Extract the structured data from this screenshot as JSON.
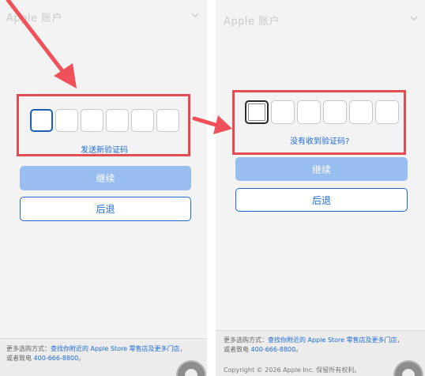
{
  "left": {
    "header_title": "Apple 账户",
    "link": "发送新验证码",
    "continue_label": "继续",
    "back_label": "后退",
    "footer_prefix": "更多选购方式：",
    "footer_link": "查找你附近的 Apple Store 零售店及更多门店",
    "footer_tail": "，",
    "footer_line2_prefix": "或者致电 ",
    "footer_phone": "400-666-8800",
    "footer_line2_suffix": "。"
  },
  "right": {
    "header_title": "Apple 账户",
    "link": "没有收到验证码?",
    "continue_label": "继续",
    "back_label": "后退",
    "footer_prefix": "更多选购方式：",
    "footer_link": "查找你附近的 Apple Store 零售店及更多门店",
    "footer_tail": "，",
    "footer_line2_prefix": "或者致电 ",
    "footer_phone": "400-666-8800",
    "footer_line2_suffix": "。",
    "copyright": "Copyright © 2026 Apple Inc. 保留所有权利。"
  },
  "colors": {
    "highlight_border": "#e54b53",
    "arrow": "#f0505a",
    "link_blue": "#1d6ad8",
    "primary_button": "#98bdf0"
  },
  "icons": {
    "chevron": "chevron-down-icon",
    "arrow": "pointer-arrow-icon"
  }
}
